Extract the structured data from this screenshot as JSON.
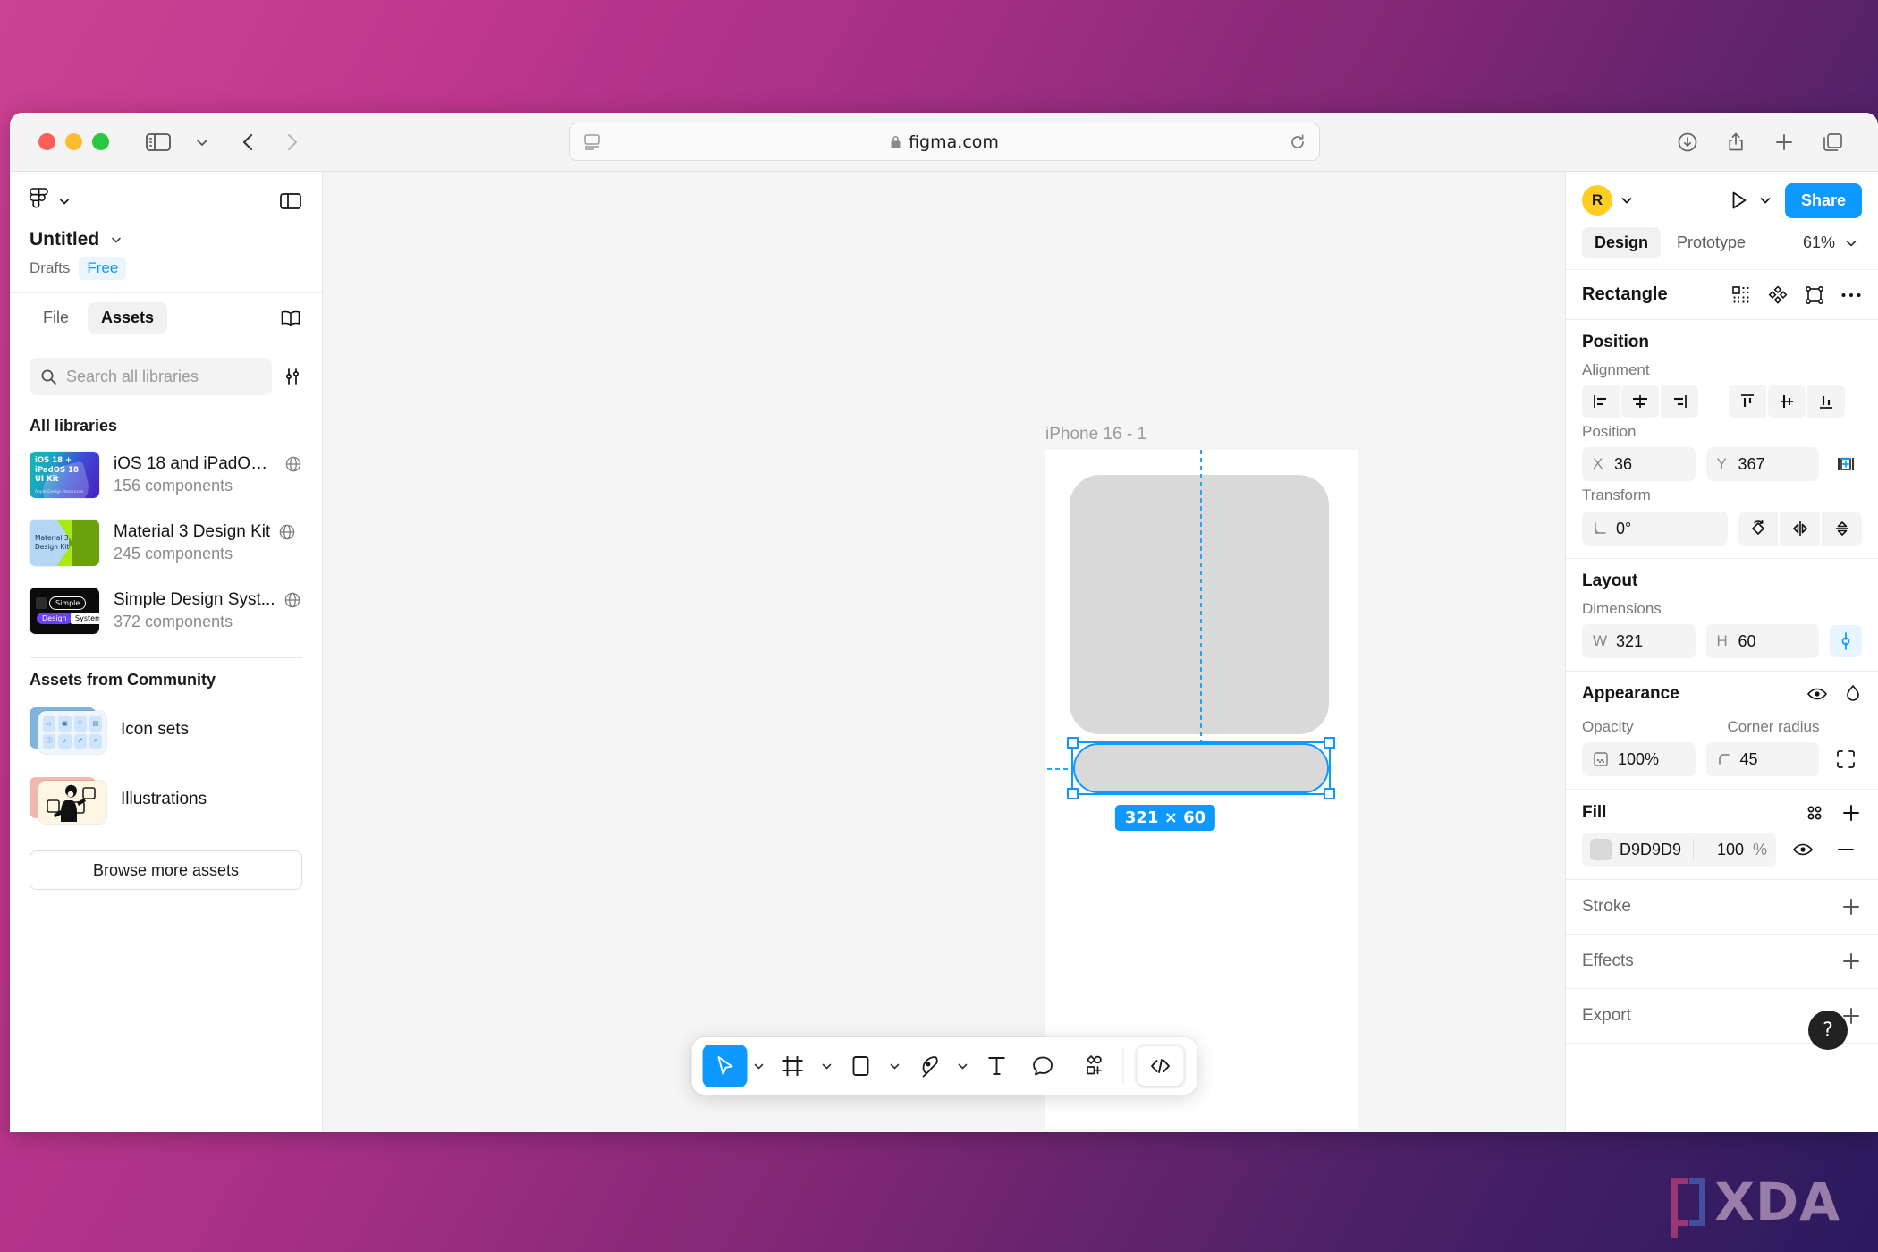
{
  "browser": {
    "url": "figma.com",
    "lock_icon": "lock-icon",
    "reader_icon": "reader-view-icon",
    "reload_icon": "reload-icon",
    "sidebar_icon": "sidebar-toggle-icon",
    "back_icon": "back-arrow-icon",
    "forward_icon": "forward-arrow-icon",
    "downloads_icon": "downloads-icon",
    "share_icon": "share-icon",
    "new_tab_icon": "plus-icon",
    "tabs_icon": "tab-overview-icon",
    "traffic_lights": [
      "close",
      "minimize",
      "zoom"
    ]
  },
  "sidebar": {
    "logo_icon": "figma-logo-icon",
    "panel_toggle_icon": "panel-toggle-icon",
    "file_name": "Untitled",
    "file_caret_icon": "chevron-down-icon",
    "folder": "Drafts",
    "plan": "Free",
    "tabs": [
      {
        "label": "File",
        "active": false
      },
      {
        "label": "Assets",
        "active": true
      }
    ],
    "book_icon": "book-icon",
    "search": {
      "placeholder": "Search all libraries",
      "value": "",
      "icon": "search-icon",
      "filter_icon": "filter-sliders-icon"
    },
    "all_libraries_heading": "All libraries",
    "libraries": [
      {
        "name": "iOS 18 and iPadOS ...",
        "components": "156 components",
        "thumb_line1": "iOS 18 + iPadOS 18",
        "thumb_line2": "UI Kit",
        "thumb_foot": "Apple Design Resources",
        "globe_icon": "globe-icon"
      },
      {
        "name": "Material 3 Design Kit",
        "components": "245 components",
        "thumb_line1": "Material 3",
        "thumb_line2": "Design Kit",
        "globe_icon": "globe-icon"
      },
      {
        "name": "Simple Design Syst...",
        "components": "372 components",
        "thumb_chip1": "Simple",
        "thumb_chip2": "Design",
        "thumb_chip3": "System",
        "globe_icon": "globe-icon"
      }
    ],
    "community_heading": "Assets from Community",
    "community": [
      {
        "label": "Icon sets",
        "thumb": "icon-grid-thumbnail"
      },
      {
        "label": "Illustrations",
        "thumb": "illustration-thumbnail"
      }
    ],
    "browse_button": "Browse more assets"
  },
  "canvas": {
    "frame_label": "iPhone 16 - 1",
    "dimension_badge": "321 × 60",
    "selected_shape_fill": "#D9D9D9",
    "guide_color": "#1EA7FD",
    "selection_color": "#0D99FF"
  },
  "toolbar": {
    "tools": [
      {
        "name": "move-tool",
        "icon": "cursor-icon",
        "active": true,
        "caret": true
      },
      {
        "name": "frame-tool",
        "icon": "frame-icon",
        "active": false,
        "caret": true
      },
      {
        "name": "shape-tool",
        "icon": "rectangle-icon",
        "active": false,
        "caret": true
      },
      {
        "name": "pen-tool",
        "icon": "pen-icon",
        "active": false,
        "caret": true
      },
      {
        "name": "text-tool",
        "icon": "text-icon",
        "active": false,
        "caret": false
      },
      {
        "name": "comment-tool",
        "icon": "comment-icon",
        "active": false,
        "caret": false
      },
      {
        "name": "actions-tool",
        "icon": "components-plus-icon",
        "active": false,
        "caret": false
      }
    ],
    "dev_mode_icon": "code-brackets-icon"
  },
  "right_panel": {
    "avatar_initial": "R",
    "avatar_color": "#FFCE21",
    "avatar_caret_icon": "chevron-down-icon",
    "present_icon": "play-icon",
    "present_caret_icon": "chevron-down-icon",
    "share_label": "Share",
    "share_color": "#0D99FF",
    "tabs": [
      {
        "label": "Design",
        "active": true
      },
      {
        "label": "Prototype",
        "active": false
      }
    ],
    "zoom_level": "61%",
    "zoom_caret_icon": "chevron-down-icon",
    "object_name": "Rectangle",
    "object_icons": [
      "component-dots-icon",
      "variants-icon",
      "boolean-icon",
      "more-options-icon"
    ],
    "position": {
      "title": "Position",
      "alignment_label": "Alignment",
      "alignment_buttons": [
        "align-left-icon",
        "align-horizontal-center-icon",
        "align-right-icon",
        "align-top-icon",
        "align-vertical-center-icon",
        "align-bottom-icon"
      ],
      "position_label": "Position",
      "x_key": "X",
      "x_value": "36",
      "y_key": "Y",
      "y_value": "367",
      "absolute_position_icon": "absolute-position-icon",
      "transform_label": "Transform",
      "rotation_icon": "angle-icon",
      "rotation_value": "0°",
      "transform_buttons": [
        "rotate-icon",
        "flip-horizontal-icon",
        "flip-vertical-icon"
      ]
    },
    "layout": {
      "title": "Layout",
      "dimensions_label": "Dimensions",
      "w_key": "W",
      "w_value": "321",
      "h_key": "H",
      "h_value": "60",
      "ratio_lock_icon": "link-ratio-icon"
    },
    "appearance": {
      "title": "Appearance",
      "visibility_icon": "eye-icon",
      "blend_icon": "blend-mode-icon",
      "opacity_label": "Opacity",
      "opacity_icon": "opacity-icon",
      "opacity_value": "100%",
      "corner_radius_label": "Corner radius",
      "corner_icon": "corner-radius-icon",
      "corner_radius_value": "45",
      "independent_corners_icon": "independent-corners-icon"
    },
    "fill": {
      "title": "Fill",
      "styles_icon": "style-dots-icon",
      "add_icon": "plus-icon",
      "swatch_hex": "D9D9D9",
      "opacity": "100",
      "percent": "%",
      "visibility_icon": "eye-icon",
      "remove_icon": "minus-icon"
    },
    "sections": [
      {
        "title": "Stroke",
        "add_icon": "plus-icon"
      },
      {
        "title": "Effects",
        "add_icon": "plus-icon"
      },
      {
        "title": "Export",
        "add_icon": "plus-icon"
      }
    ],
    "help_label": "?"
  },
  "watermark": {
    "text": "XDA"
  }
}
